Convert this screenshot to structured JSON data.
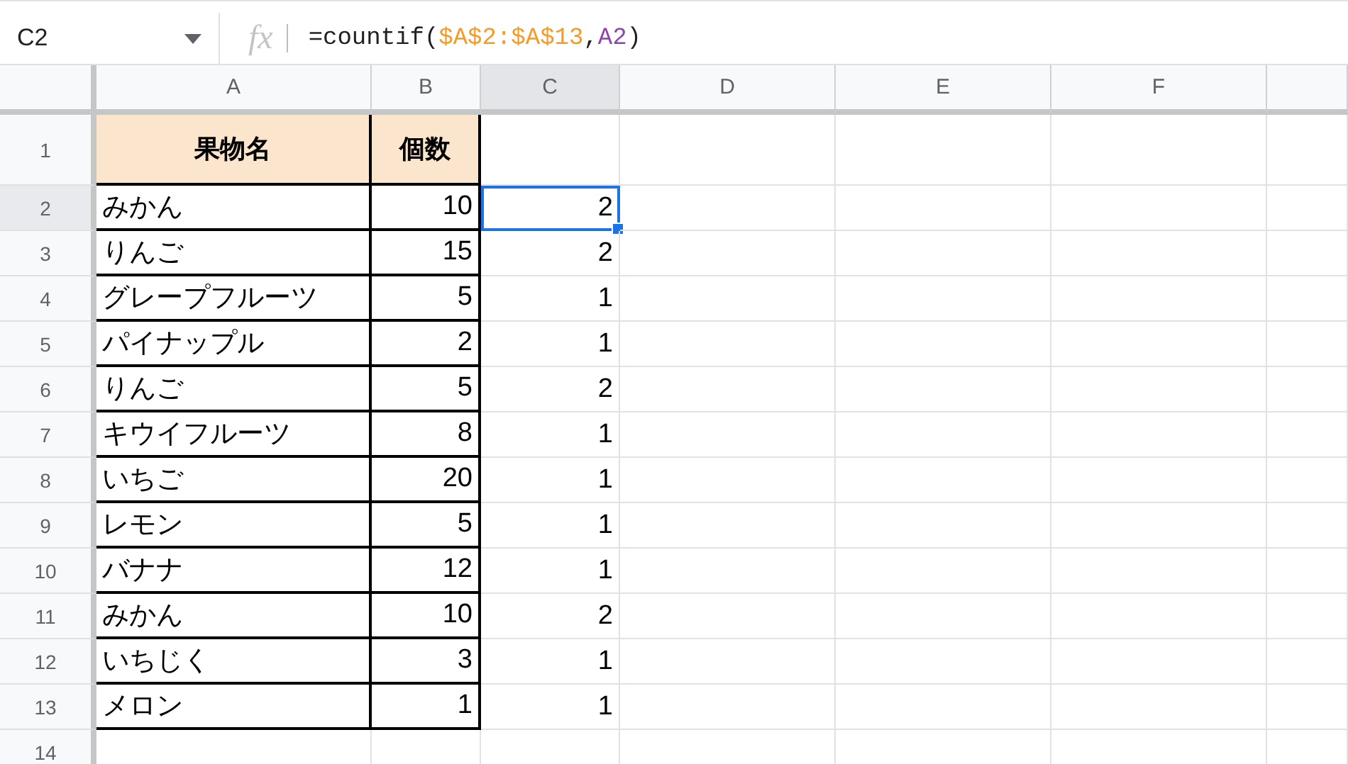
{
  "formula_bar": {
    "name_box": "C2",
    "fx": "fx",
    "formula_parts": [
      {
        "text": "=countif(",
        "color": "#202124"
      },
      {
        "text": "$A$2:$A$13",
        "color": "#f79a24"
      },
      {
        "text": ",",
        "color": "#202124"
      },
      {
        "text": "A2",
        "color": "#8e44ad"
      },
      {
        "text": ")",
        "color": "#202124"
      }
    ]
  },
  "columns": [
    {
      "label": "A",
      "selected": false
    },
    {
      "label": "B",
      "selected": false
    },
    {
      "label": "C",
      "selected": true
    },
    {
      "label": "D",
      "selected": false
    },
    {
      "label": "E",
      "selected": false
    },
    {
      "label": "F",
      "selected": false
    }
  ],
  "header_row": {
    "number": "1",
    "cells": [
      "果物名",
      "個数"
    ]
  },
  "rows": [
    {
      "number": "2",
      "name": "みかん",
      "count": "10",
      "result": "2",
      "selected": true
    },
    {
      "number": "3",
      "name": "りんご",
      "count": "15",
      "result": "2",
      "selected": false
    },
    {
      "number": "4",
      "name": "グレープフルーツ",
      "count": "5",
      "result": "1",
      "selected": false
    },
    {
      "number": "5",
      "name": "パイナップル",
      "count": "2",
      "result": "1",
      "selected": false
    },
    {
      "number": "6",
      "name": "りんご",
      "count": "5",
      "result": "2",
      "selected": false
    },
    {
      "number": "7",
      "name": "キウイフルーツ",
      "count": "8",
      "result": "1",
      "selected": false
    },
    {
      "number": "8",
      "name": "いちご",
      "count": "20",
      "result": "1",
      "selected": false
    },
    {
      "number": "9",
      "name": "レモン",
      "count": "5",
      "result": "1",
      "selected": false
    },
    {
      "number": "10",
      "name": "バナナ",
      "count": "12",
      "result": "1",
      "selected": false
    },
    {
      "number": "11",
      "name": "みかん",
      "count": "10",
      "result": "2",
      "selected": false
    },
    {
      "number": "12",
      "name": "いちじく",
      "count": "3",
      "result": "1",
      "selected": false
    },
    {
      "number": "13",
      "name": "メロン",
      "count": "1",
      "result": "1",
      "selected": false
    }
  ],
  "empty_rows": [
    "14"
  ]
}
